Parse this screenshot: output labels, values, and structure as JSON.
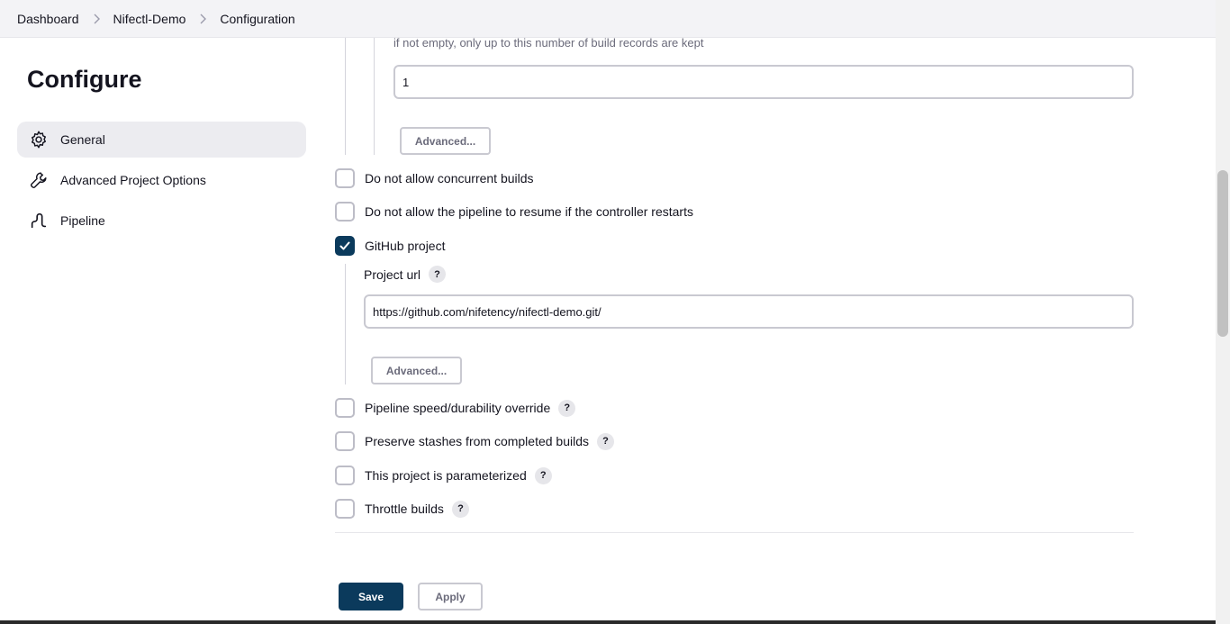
{
  "breadcrumb": {
    "items": [
      "Dashboard",
      "Nifectl-Demo",
      "Configuration"
    ]
  },
  "sidebar": {
    "title": "Configure",
    "items": [
      {
        "label": "General",
        "icon": "gear-icon",
        "active": true
      },
      {
        "label": "Advanced Project Options",
        "icon": "wrench-icon",
        "active": false
      },
      {
        "label": "Pipeline",
        "icon": "pipeline-icon",
        "active": false
      }
    ]
  },
  "build_records": {
    "help": "if not empty, only up to this number of build records are kept",
    "value": "1",
    "advanced_label": "Advanced..."
  },
  "options": {
    "no_concurrent": {
      "label": "Do not allow concurrent builds",
      "checked": false
    },
    "no_resume": {
      "label": "Do not allow the pipeline to resume if the controller restarts",
      "checked": false
    },
    "github_project": {
      "label": "GitHub project",
      "checked": true
    },
    "speed_override": {
      "label": "Pipeline speed/durability override",
      "checked": false,
      "help": "?"
    },
    "preserve_stashes": {
      "label": "Preserve stashes from completed builds",
      "checked": false,
      "help": "?"
    },
    "parameterized": {
      "label": "This project is parameterized",
      "checked": false,
      "help": "?"
    },
    "throttle": {
      "label": "Throttle builds",
      "checked": false,
      "help": "?"
    }
  },
  "github": {
    "project_url_label": "Project url",
    "help": "?",
    "project_url_value": "https://github.com/nifetency/nifectl-demo.git/",
    "advanced_label": "Advanced..."
  },
  "actions": {
    "save_label": "Save",
    "apply_label": "Apply"
  },
  "colors": {
    "primary": "#0b3a5c",
    "active_nav_bg": "#ececf0"
  }
}
